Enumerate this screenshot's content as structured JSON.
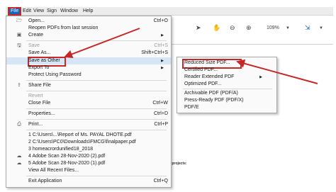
{
  "menubar": {
    "items": [
      "File",
      "Edit",
      "View",
      "Sign",
      "Window",
      "Help"
    ]
  },
  "toolbar": {
    "zoom": "109%"
  },
  "doc": {
    "fragment": "d projects:"
  },
  "file_menu": {
    "items": [
      {
        "label": "Open...",
        "shortcut": "Ctrl+O",
        "icon": "folder-icon"
      },
      {
        "label": "Reopen PDFs from last session",
        "shortcut": ""
      },
      {
        "label": "Create",
        "shortcut": "",
        "submenu": true
      },
      {
        "label": "Save",
        "shortcut": "Ctrl+S",
        "disabled": true
      },
      {
        "label": "Save As...",
        "shortcut": "Shift+Ctrl+S"
      },
      {
        "label": "Save as Other",
        "shortcut": "",
        "submenu": true
      },
      {
        "label": "Export To",
        "shortcut": "",
        "submenu": true
      },
      {
        "label": "Protect Using Password",
        "shortcut": ""
      },
      {
        "label": "Share File",
        "shortcut": "",
        "icon": "share-icon"
      },
      {
        "label": "Revert",
        "shortcut": "",
        "disabled": true
      },
      {
        "label": "Close File",
        "shortcut": "Ctrl+W"
      },
      {
        "label": "Properties...",
        "shortcut": "Ctrl+D"
      },
      {
        "label": "Print...",
        "shortcut": "Ctrl+P",
        "icon": "print-icon"
      },
      {
        "label": "1 C:\\Users\\...\\Report of Ms. PAYAL DHOTE.pdf"
      },
      {
        "label": "2 C:\\Users\\PC0\\Downloads\\FMCG\\finalpaper.pdf"
      },
      {
        "label": "3 homeacrordunified18_2018"
      },
      {
        "label": "4 Adobe Scan 28-Nov-2020 (2).pdf",
        "icon": "cloud-icon"
      },
      {
        "label": "5 Adobe Scan 28-Nov-2020 (1).pdf",
        "icon": "cloud-icon"
      },
      {
        "label": "View All Recent Files..."
      },
      {
        "label": "Exit Application",
        "shortcut": "Ctrl+Q"
      }
    ]
  },
  "save_as_other_menu": {
    "items": [
      {
        "label": "Reduced Size PDF..."
      },
      {
        "label": "Certified PDF..."
      },
      {
        "label": "Reader Extended PDF",
        "submenu": true
      },
      {
        "label": "Optimized PDF..."
      },
      {
        "label": "Archivable PDF (PDF/A)"
      },
      {
        "label": "Press-Ready PDF (PDF/X)"
      },
      {
        "label": "PDF/E"
      }
    ]
  },
  "colors": {
    "highlight_border": "#c62828",
    "hover_bg": "#d6e6f7",
    "arrow": "#c62828"
  }
}
